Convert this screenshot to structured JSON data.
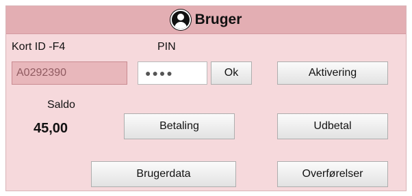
{
  "header": {
    "title": "Bruger",
    "icon": "user-circle-icon"
  },
  "card": {
    "label": "Kort ID -F4",
    "value": "A0292390"
  },
  "pin": {
    "label": "PIN",
    "value": "●●●●"
  },
  "buttons": {
    "ok": "Ok",
    "aktivering": "Aktivering",
    "betaling": "Betaling",
    "udbetal": "Udbetal",
    "brugerdata": "Brugerdata",
    "overforsler": "Overførelser"
  },
  "saldo": {
    "label": "Saldo",
    "value": "45,00"
  },
  "colors": {
    "panel_bg": "#f6d9dc",
    "header_bg": "#e3aeb3",
    "card_field_bg": "#e8b7bb"
  }
}
